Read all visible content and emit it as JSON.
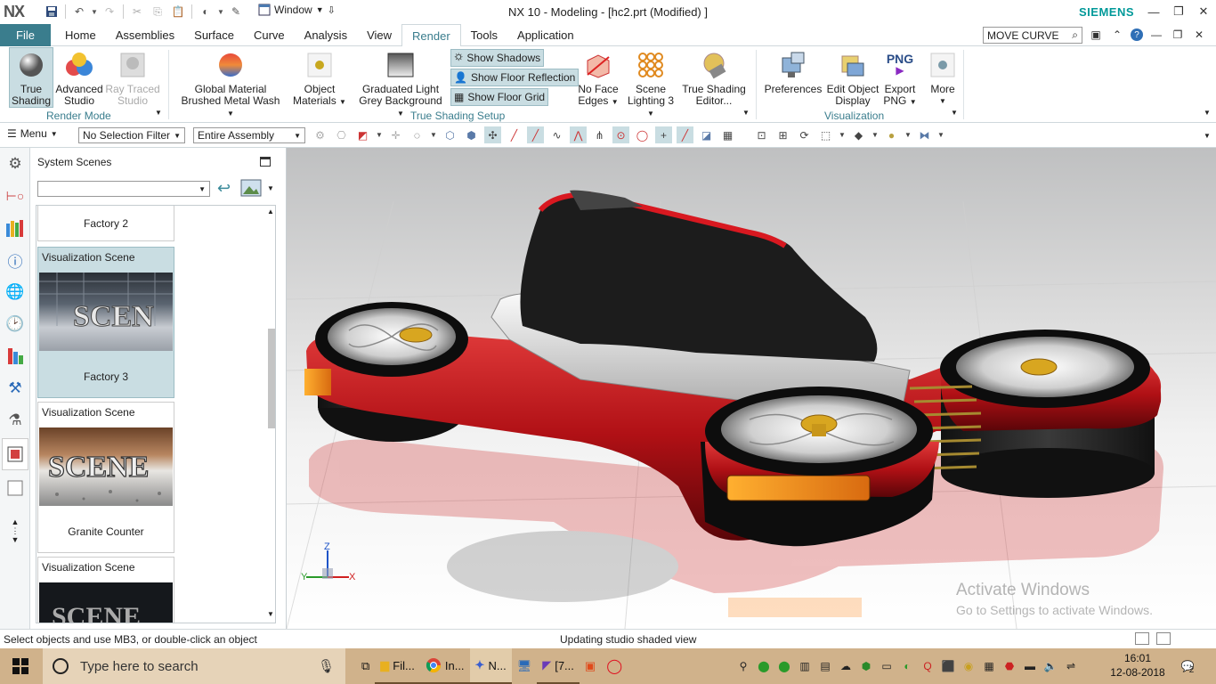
{
  "titlebar": {
    "logo": "NX",
    "window_menu": "Window",
    "title": "NX 10 - Modeling - [hc2.prt (Modified) ]",
    "brand": "SIEMENS"
  },
  "tabs": {
    "file": "File",
    "items": [
      "Home",
      "Assemblies",
      "Surface",
      "Curve",
      "Analysis",
      "View",
      "Render",
      "Tools",
      "Application"
    ],
    "active": "Render",
    "command_search": "MOVE CURVE"
  },
  "ribbon": {
    "true_shading": "True\nShading",
    "advanced_studio": "Advanced\nStudio",
    "ray_traced_studio": "Ray Traced\nStudio",
    "render_mode_label": "Render Mode",
    "global_material": "Global Material",
    "global_material_value": "Brushed Metal Wash",
    "object_materials_1": "Object",
    "object_materials_2": "Materials",
    "graduated_light": "Graduated Light",
    "graduated_light_value": "Grey Background",
    "show_shadows": "Show Shadows",
    "show_floor_reflection": "Show Floor Reflection",
    "show_floor_grid": "Show Floor Grid",
    "no_face_edges_1": "No Face",
    "no_face_edges_2": "Edges",
    "scene_lighting_1": "Scene",
    "scene_lighting_2": "Lighting 3",
    "true_shading_editor_1": "True Shading",
    "true_shading_editor_2": "Editor...",
    "true_shading_setup_label": "True Shading Setup",
    "preferences": "Preferences",
    "edit_object_display_1": "Edit Object",
    "edit_object_display_2": "Display",
    "export_png_1": "Export",
    "export_png_2": "PNG",
    "png_icon_text": "PNG",
    "more": "More",
    "visualization_label": "Visualization"
  },
  "selection_bar": {
    "menu": "Menu",
    "selection_filter": "No Selection Filter",
    "scope": "Entire Assembly"
  },
  "panel": {
    "title": "System Scenes",
    "scenes": [
      {
        "header": "",
        "name": "Factory 2",
        "selected": false
      },
      {
        "header": "Visualization Scene",
        "name": "Factory 3",
        "selected": true
      },
      {
        "header": "Visualization Scene",
        "name": "Granite Counter",
        "selected": false
      },
      {
        "header": "Visualization Scene",
        "name": "",
        "selected": false
      }
    ],
    "thumb_text": "SCENE"
  },
  "viewport": {
    "triad": {
      "z": "Z",
      "y": "Y",
      "x": "X"
    },
    "watermark_line1": "Activate Windows",
    "watermark_line2": "Go to Settings to activate Windows."
  },
  "statusbar": {
    "left": "Select objects and use MB3, or double-click an object",
    "middle": "Updating studio shaded view"
  },
  "taskbar": {
    "search_placeholder": "Type here to search",
    "apps": [
      {
        "label": "Fil...",
        "icon": "folder-icon"
      },
      {
        "label": "In...",
        "icon": "chrome-icon"
      },
      {
        "label": "N...",
        "icon": "nx-icon"
      },
      {
        "label": "",
        "icon": "desktop-icon"
      },
      {
        "label": "[7...",
        "icon": "visual-studio-icon"
      },
      {
        "label": "",
        "icon": "app-icon"
      },
      {
        "label": "",
        "icon": "opera-icon"
      }
    ],
    "time": "16:01",
    "date": "12-08-2018",
    "notifications": "2"
  },
  "colors": {
    "accent": "#3a7d8d",
    "brand": "#009999",
    "taskbar": "#d0b28b",
    "body_red": "#c0141a"
  }
}
